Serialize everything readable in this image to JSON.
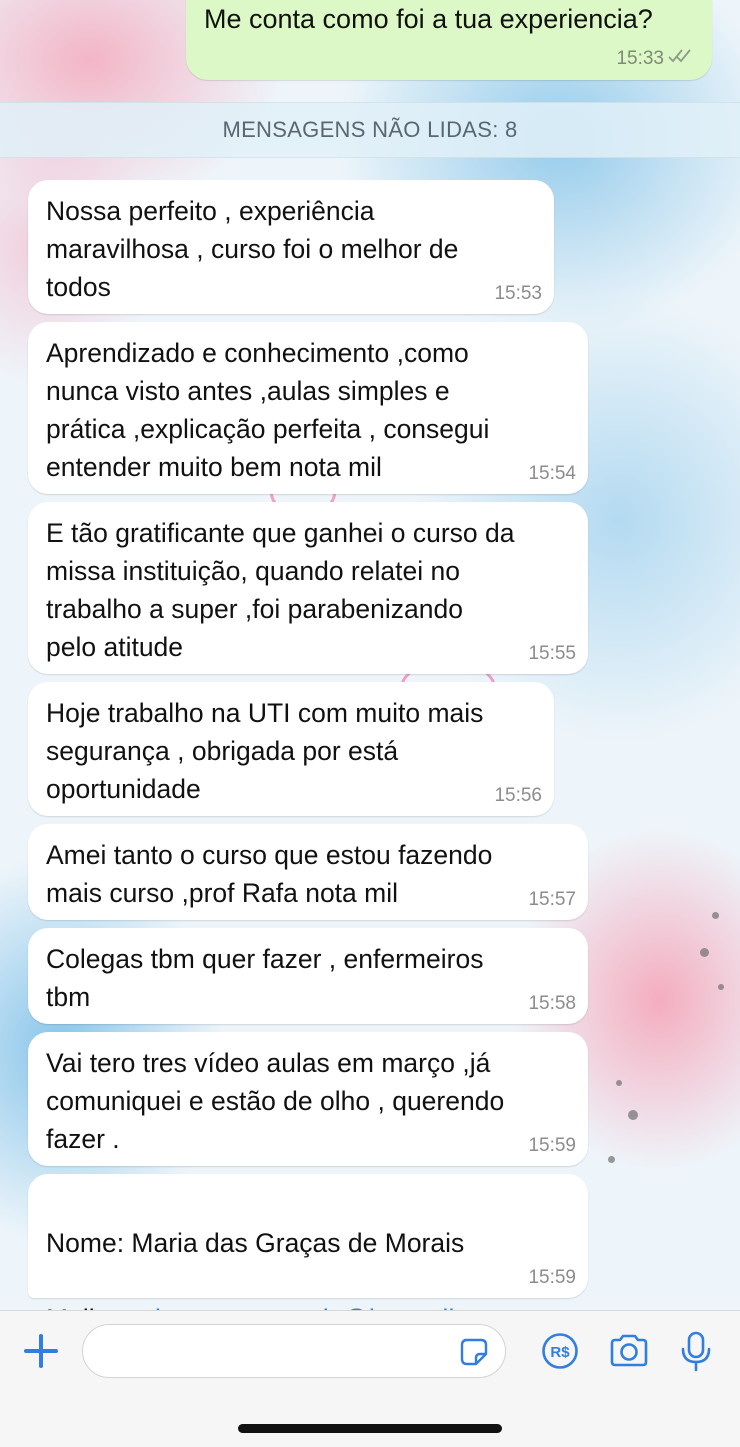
{
  "colors": {
    "outgoing_bubble": "#dcf8c6",
    "incoming_bubble": "#ffffff",
    "accent": "#2f7ee0",
    "link": "#2f7ec8"
  },
  "outgoing_message": {
    "text": "Me conta como foi a tua experiencia?",
    "time": "15:33",
    "status_icon": "double-check-icon"
  },
  "unread_divider": {
    "label": "MENSAGENS NÃO LIDAS: 8"
  },
  "messages": [
    {
      "text": "Nossa perfeito , experiência\nmaravilhosa , curso foi o melhor de\ntodos",
      "time": "15:53"
    },
    {
      "text": "Aprendizado e conhecimento ,como\nnunca visto antes ,aulas simples e\nprática ,explicação perfeita , consegui\nentender muito bem nota mil",
      "time": "15:54"
    },
    {
      "text": "E tão gratificante que ganhei o curso da\nmissa instituição, quando relatei no\ntrabalho a super ,foi parabenizando\npelo atitude",
      "time": "15:55"
    },
    {
      "text": "Hoje trabalho na UTI com muito mais\nsegurança , obrigada por está\noportunidade",
      "time": "15:56"
    },
    {
      "text": "Amei tanto o curso que estou fazendo\nmais curso ,prof Rafa nota mil",
      "time": "15:57"
    },
    {
      "text": "Colegas tbm quer fazer , enfermeiros\ntbm",
      "time": "15:58"
    },
    {
      "text": "Vai tero tres vídeo aulas em março ,já\ncomuniquei e estão de olho , querendo\nfazer .",
      "time": "15:59"
    }
  ],
  "contact_message": {
    "name_line": "Nome: Maria das Graças de Morais",
    "mail_label": "Mail: ",
    "mail_link": "maria.gracasmorais@hotmail.com",
    "time": "15:59"
  },
  "input_bar": {
    "message_placeholder": "",
    "icons": [
      "plus-icon",
      "sticker-icon",
      "payment-icon",
      "camera-icon",
      "microphone-icon"
    ],
    "payment_glyph": "R$"
  }
}
